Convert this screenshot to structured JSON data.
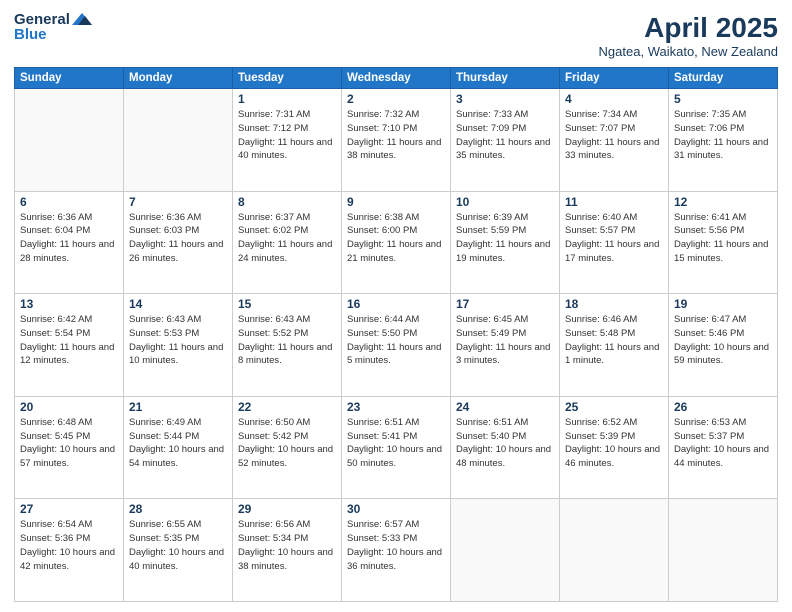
{
  "header": {
    "logo_general": "General",
    "logo_blue": "Blue",
    "title": "April 2025",
    "location": "Ngatea, Waikato, New Zealand"
  },
  "days_of_week": [
    "Sunday",
    "Monday",
    "Tuesday",
    "Wednesday",
    "Thursday",
    "Friday",
    "Saturday"
  ],
  "weeks": [
    [
      {
        "day": "",
        "detail": ""
      },
      {
        "day": "",
        "detail": ""
      },
      {
        "day": "1",
        "detail": "Sunrise: 7:31 AM\nSunset: 7:12 PM\nDaylight: 11 hours and 40 minutes."
      },
      {
        "day": "2",
        "detail": "Sunrise: 7:32 AM\nSunset: 7:10 PM\nDaylight: 11 hours and 38 minutes."
      },
      {
        "day": "3",
        "detail": "Sunrise: 7:33 AM\nSunset: 7:09 PM\nDaylight: 11 hours and 35 minutes."
      },
      {
        "day": "4",
        "detail": "Sunrise: 7:34 AM\nSunset: 7:07 PM\nDaylight: 11 hours and 33 minutes."
      },
      {
        "day": "5",
        "detail": "Sunrise: 7:35 AM\nSunset: 7:06 PM\nDaylight: 11 hours and 31 minutes."
      }
    ],
    [
      {
        "day": "6",
        "detail": "Sunrise: 6:36 AM\nSunset: 6:04 PM\nDaylight: 11 hours and 28 minutes."
      },
      {
        "day": "7",
        "detail": "Sunrise: 6:36 AM\nSunset: 6:03 PM\nDaylight: 11 hours and 26 minutes."
      },
      {
        "day": "8",
        "detail": "Sunrise: 6:37 AM\nSunset: 6:02 PM\nDaylight: 11 hours and 24 minutes."
      },
      {
        "day": "9",
        "detail": "Sunrise: 6:38 AM\nSunset: 6:00 PM\nDaylight: 11 hours and 21 minutes."
      },
      {
        "day": "10",
        "detail": "Sunrise: 6:39 AM\nSunset: 5:59 PM\nDaylight: 11 hours and 19 minutes."
      },
      {
        "day": "11",
        "detail": "Sunrise: 6:40 AM\nSunset: 5:57 PM\nDaylight: 11 hours and 17 minutes."
      },
      {
        "day": "12",
        "detail": "Sunrise: 6:41 AM\nSunset: 5:56 PM\nDaylight: 11 hours and 15 minutes."
      }
    ],
    [
      {
        "day": "13",
        "detail": "Sunrise: 6:42 AM\nSunset: 5:54 PM\nDaylight: 11 hours and 12 minutes."
      },
      {
        "day": "14",
        "detail": "Sunrise: 6:43 AM\nSunset: 5:53 PM\nDaylight: 11 hours and 10 minutes."
      },
      {
        "day": "15",
        "detail": "Sunrise: 6:43 AM\nSunset: 5:52 PM\nDaylight: 11 hours and 8 minutes."
      },
      {
        "day": "16",
        "detail": "Sunrise: 6:44 AM\nSunset: 5:50 PM\nDaylight: 11 hours and 5 minutes."
      },
      {
        "day": "17",
        "detail": "Sunrise: 6:45 AM\nSunset: 5:49 PM\nDaylight: 11 hours and 3 minutes."
      },
      {
        "day": "18",
        "detail": "Sunrise: 6:46 AM\nSunset: 5:48 PM\nDaylight: 11 hours and 1 minute."
      },
      {
        "day": "19",
        "detail": "Sunrise: 6:47 AM\nSunset: 5:46 PM\nDaylight: 10 hours and 59 minutes."
      }
    ],
    [
      {
        "day": "20",
        "detail": "Sunrise: 6:48 AM\nSunset: 5:45 PM\nDaylight: 10 hours and 57 minutes."
      },
      {
        "day": "21",
        "detail": "Sunrise: 6:49 AM\nSunset: 5:44 PM\nDaylight: 10 hours and 54 minutes."
      },
      {
        "day": "22",
        "detail": "Sunrise: 6:50 AM\nSunset: 5:42 PM\nDaylight: 10 hours and 52 minutes."
      },
      {
        "day": "23",
        "detail": "Sunrise: 6:51 AM\nSunset: 5:41 PM\nDaylight: 10 hours and 50 minutes."
      },
      {
        "day": "24",
        "detail": "Sunrise: 6:51 AM\nSunset: 5:40 PM\nDaylight: 10 hours and 48 minutes."
      },
      {
        "day": "25",
        "detail": "Sunrise: 6:52 AM\nSunset: 5:39 PM\nDaylight: 10 hours and 46 minutes."
      },
      {
        "day": "26",
        "detail": "Sunrise: 6:53 AM\nSunset: 5:37 PM\nDaylight: 10 hours and 44 minutes."
      }
    ],
    [
      {
        "day": "27",
        "detail": "Sunrise: 6:54 AM\nSunset: 5:36 PM\nDaylight: 10 hours and 42 minutes."
      },
      {
        "day": "28",
        "detail": "Sunrise: 6:55 AM\nSunset: 5:35 PM\nDaylight: 10 hours and 40 minutes."
      },
      {
        "day": "29",
        "detail": "Sunrise: 6:56 AM\nSunset: 5:34 PM\nDaylight: 10 hours and 38 minutes."
      },
      {
        "day": "30",
        "detail": "Sunrise: 6:57 AM\nSunset: 5:33 PM\nDaylight: 10 hours and 36 minutes."
      },
      {
        "day": "",
        "detail": ""
      },
      {
        "day": "",
        "detail": ""
      },
      {
        "day": "",
        "detail": ""
      }
    ]
  ]
}
